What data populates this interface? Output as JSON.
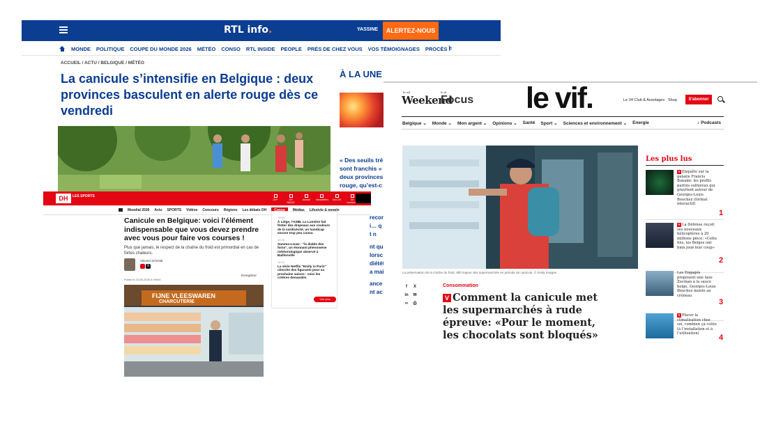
{
  "rtl": {
    "logo_text": "RTL info",
    "user_name": "YASSINE",
    "alert_button": "ALERTEZ-NOUS",
    "nav_items": [
      "MONDE",
      "POLITIQUE",
      "COUPE DU MONDE 2026",
      "MÉTÉO",
      "CONSO",
      "RTL INSIDE",
      "PEOPLE",
      "PRÈS DE CHEZ VOUS",
      "VOS TÉMOIGNAGES",
      "PROCÈS F"
    ],
    "breadcrumb": "ACCUEIL / ACTU / BELGIQUE / MÉTÉO",
    "headline": "La canicule s’intensifie en Belgique : deux provinces basculent en alerte rouge dès ce vendredi",
    "a_la_une_title": "À LA UNE",
    "a_la_une_text": "« Des seuils trè sont franchis » deux provinces rouge, qu’est-c",
    "side_fragments": [
      "recor",
      "i… q",
      "t n",
      "nt qu'",
      "lorsc",
      "diétét",
      "a mai",
      "ance",
      "nt ac"
    ]
  },
  "dh": {
    "logo_text": "DH",
    "logo_sub": "LES SPORTS",
    "header_icons": [
      "DH+",
      "DH RADIO",
      "Journal",
      "Newsletters",
      "Nos DH",
      "Se connecter"
    ],
    "subnav": [
      "Mondial 2026",
      "Actu",
      "SPORTS",
      "Vidéos",
      "Concours",
      "Régions",
      "Les débats DH",
      "Conso",
      "Médias",
      "Lifestyle & people"
    ],
    "article_title": "Canicule en Belgique: voici l’élément indispensable que vous devez prendre avec vous pour faire vos courses !",
    "article_lead": "Plus que jamais, le respect de la chaîne du froid est primordial en cas de fortes chaleurs.",
    "author": "Vincent Schmidt",
    "save_label": "Enregistrer",
    "published": "Publié le 23-06-2026 à 09h00",
    "photo_sign_1": "FIJNE VLEESWAREN",
    "photo_sign_2": "CHARCUTERIE",
    "ticker": [
      {
        "time": "15:50",
        "text": "À Liège, l’ASBL La Lumière fait flotter des drapeaux aux couleurs de la surdicécité, un handicap encore trop peu connu"
      },
      {
        "time": "15:26",
        "text": "Somme-Leuze : \"le diable des foins\", un étonnant phénomène météorologique observé à Baillonville"
      },
      {
        "time": "15:13",
        "text": "La série Netflix \"Emily in Paris\" cherche des figurants pour sa prochaine saison : voici les critères demandés"
      }
    ],
    "ticker_more": "Voir plus"
  },
  "vif": {
    "weekend_small": "le vif",
    "weekend_label": "Weekend",
    "focus_small": "le vif",
    "focus_label": "Focus",
    "brand": "le vif.",
    "club_link": "Le Vif Club & Avantages",
    "shop_link": "Shop",
    "subscribe_button": "S'abonner",
    "nav_items": [
      "Belgique",
      "Monde",
      "Mon argent",
      "Opinions",
      "Santé",
      "Sport",
      "Sciences et environnement",
      "Energie"
    ],
    "podcasts": "Podcasts",
    "photo_caption": "La préservation de la chaîne du froid, défi majeur des supermarchés en période de canicule. © Getty Images",
    "section": "Consommation",
    "headline": "Comment la canicule met les supermarchés à rude épreuve: «Pour le moment, les chocolats sont bloqués»",
    "plus_lus_title": "Les plus lus",
    "plus_lus": [
      {
        "rank": "1",
        "text": "Enquête sur la galaxie Francis Bonaïm: les profils parfois sulfureux qui gravitent autour de Georges-Louis Bouchez (format interactif)"
      },
      {
        "rank": "2",
        "text": "La Défense reçoit ses nouveaux hélicoptères à 20 millions pièce: «Cette fois, les Belges ont bien joué leur coup»"
      },
      {
        "rank": "3",
        "text": "Les Engagés proposent une taxe Zucman à la sauce belge, Georges-Louis Bouchez monte au créneau"
      },
      {
        "rank": "4",
        "text": "Placer la climatisation chez soi, combien ça coûte (à l’installation et à l’utilisation)"
      }
    ]
  }
}
